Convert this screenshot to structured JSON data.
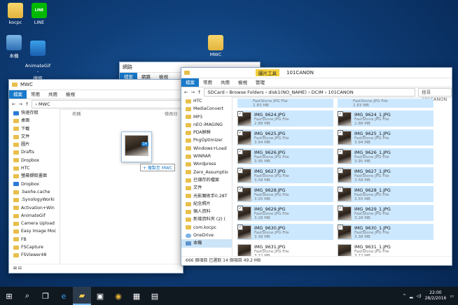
{
  "desktop": {
    "icons": [
      {
        "label": "kocpc"
      },
      {
        "label": "LINE"
      },
      {
        "label": "本機"
      },
      {
        "label": "AnimateGif -\n捷徑"
      },
      {
        "label": "MWC"
      }
    ],
    "line_logo": "LINE"
  },
  "back_window": {
    "title": "網路",
    "tabs": [
      "檔案",
      "網路",
      "檢視"
    ]
  },
  "mwc_window": {
    "title": "MWC",
    "tabs": [
      "檔案",
      "常用",
      "共用",
      "檢視"
    ],
    "path": "MWC",
    "col_name": "名稱",
    "col_date": "修改日",
    "nav": [
      "快速存取",
      "桌面",
      "下載",
      "文件",
      "圖片",
      "Drafts",
      "Dropbox",
      "HTC",
      "螢幕擷取畫面",
      "Dropbox",
      ".baohe.cache",
      ".SynologyWorki",
      "Activation+Win",
      "AnimateGif",
      "Camera Upload",
      "Easy Image Moc",
      "FB",
      "FSCapture",
      "FSViewer48"
    ],
    "drag_tooltip": "+ 複製至 MWC",
    "drag_count": "14"
  },
  "main_window": {
    "title": "101CANON",
    "tool_badge": "圖片工具",
    "tabs": [
      "檔案",
      "常用",
      "共用",
      "檢視",
      "管理"
    ],
    "breadcrumb": [
      "SDCard",
      "Browse Folders",
      "disk1(NO_NAME)",
      "DCIM",
      "101CANON"
    ],
    "search_placeholder": "搜尋 101CANON",
    "nav": [
      "HTC",
      "MediaConvert",
      "MP3",
      "nEO iMAGING",
      "PDA鮮鮮",
      "PngOptimizer",
      "Windows+Load",
      "WINRAR",
      "Wordpress",
      "Zero_Assumptio",
      "已儲存的檔案",
      "文件",
      "光影魔術手0.28T",
      "紀念照片",
      "個人資料",
      "新增資料夾 (2) (",
      "com.kocpc",
      "OneDrive",
      "本機"
    ],
    "files": [
      {
        "name": "FastStone JPG File",
        "type": "2.83 MB",
        "size": "",
        "sel": true,
        "partial": true
      },
      {
        "name": "FastStone JPG File",
        "type": "2.83 MB",
        "size": "",
        "sel": true,
        "partial": true
      },
      {
        "name": "IMG_9624.JPG",
        "type": "FastStone JPG File",
        "size": "2.88 MB",
        "sel": true
      },
      {
        "name": "IMG_9624_1.JPG",
        "type": "FastStone JPG File",
        "size": "2.88 MB",
        "sel": true
      },
      {
        "name": "IMG_9625.JPG",
        "type": "FastStone JPG File",
        "size": "3.94 MB",
        "sel": true
      },
      {
        "name": "IMG_9625_1.JPG",
        "type": "FastStone JPG File",
        "size": "3.94 MB",
        "sel": true
      },
      {
        "name": "IMG_9626.JPG",
        "type": "FastStone JPG File",
        "size": "3.95 MB",
        "sel": true
      },
      {
        "name": "IMG_9626_1.JPG",
        "type": "FastStone JPG File",
        "size": "3.95 MB",
        "sel": true
      },
      {
        "name": "IMG_9627.JPG",
        "type": "FastStone JPG File",
        "size": "3.58 MB",
        "sel": true
      },
      {
        "name": "IMG_9627_1.JPG",
        "type": "FastStone JPG File",
        "size": "3.58 MB",
        "sel": true
      },
      {
        "name": "IMG_9628.JPG",
        "type": "FastStone JPG File",
        "size": "3.55 MB",
        "sel": true
      },
      {
        "name": "IMG_9628_1.JPG",
        "type": "FastStone JPG File",
        "size": "3.55 MB",
        "sel": true
      },
      {
        "name": "IMG_9629.JPG",
        "type": "FastStone JPG File",
        "size": "3.28 MB",
        "sel": true
      },
      {
        "name": "IMG_9629_1.JPG",
        "type": "FastStone JPG File",
        "size": "3.28 MB",
        "sel": true
      },
      {
        "name": "IMG_9630.JPG",
        "type": "FastStone JPG File",
        "size": "3.38 MB",
        "sel": true
      },
      {
        "name": "IMG_9630_1.JPG",
        "type": "FastStone JPG File",
        "size": "3.38 MB",
        "sel": true
      },
      {
        "name": "IMG_9631.JPG",
        "type": "FastStone JPG File",
        "size": "3.72 MB",
        "sel": false
      },
      {
        "name": "IMG_9631_1.JPG",
        "type": "FastStone JPG File",
        "size": "3.72 MB",
        "sel": false
      }
    ],
    "status": "666 個項目   已選取 14 個項目  49.2 MB"
  },
  "taskbar": {
    "clock_time": "22:00",
    "clock_date": "28/2/2016"
  },
  "colors": {
    "accent": "#1979ca",
    "selection": "#cce8ff"
  }
}
